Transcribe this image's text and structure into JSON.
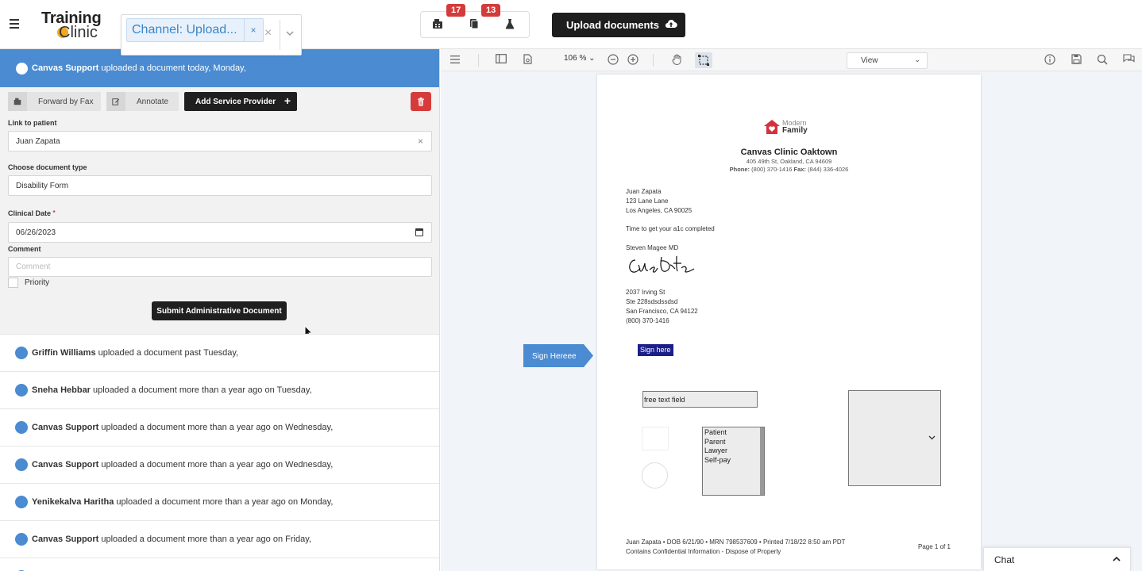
{
  "header": {
    "logo_line1": "Training",
    "logo_line2": "Clinic",
    "channel_chip": "Channel: Upload...",
    "chip_remove": "×",
    "clear": "×",
    "icons": [
      {
        "name": "fax-icon",
        "badge": "17"
      },
      {
        "name": "documents-icon",
        "badge": "13"
      },
      {
        "name": "lab-flask-icon",
        "badge": ""
      }
    ],
    "upload_label": "Upload documents"
  },
  "current_doc": {
    "user": "Canvas Support",
    "text": "uploaded a document today, Monday,"
  },
  "toolbar": {
    "forward_fax": "Forward by Fax",
    "annotate": "Annotate",
    "add_provider": "Add Service Provider"
  },
  "form": {
    "link_label": "Link to patient",
    "patient": "Juan Zapata",
    "doctype_label": "Choose document type",
    "doctype": "Disability Form",
    "clinical_date_label": "Clinical Date",
    "required_mark": "*",
    "clinical_date": "06/26/2023",
    "comment_label": "Comment",
    "comment_placeholder": "Comment",
    "priority_label": "Priority",
    "submit_label": "Submit Administrative Document"
  },
  "history": [
    {
      "user": "Griffin Williams",
      "text": "uploaded a document past Tuesday,"
    },
    {
      "user": "Sneha Hebbar",
      "text": "uploaded a document more than a year ago on Tuesday,"
    },
    {
      "user": "Canvas Support",
      "text": "uploaded a document more than a year ago on Wednesday,"
    },
    {
      "user": "Canvas Support",
      "text": "uploaded a document more than a year ago on Wednesday,"
    },
    {
      "user": "Yenikekalva Haritha",
      "text": "uploaded a document more than a year ago on Monday,"
    },
    {
      "user": "Canvas Support",
      "text": "uploaded a document more than a year ago on Friday,"
    }
  ],
  "viewer": {
    "zoom": "106 %",
    "view_mode": "View"
  },
  "document": {
    "logo_text_1": "Modern",
    "logo_text_2": "Family",
    "clinic_name": "Canvas Clinic Oaktown",
    "clinic_address": "405 49th St, Oakland, CA 94609",
    "phone_label": "Phone:",
    "phone": "(800) 370-1416",
    "fax_label": "Fax:",
    "fax": "(844) 336-4026",
    "recipient_lines": [
      "Juan Zapata",
      "123 Lane Lane",
      "Los Angeles, CA 90025"
    ],
    "message": "Time to get your a1c completed",
    "signer": "Steven Magee MD",
    "signature_text": "Carla Deta",
    "sender_lines": [
      "2037 Irving St",
      "Ste 228sdsdssdsd",
      "San Francisco, CA 94122",
      "(800) 370-1416"
    ],
    "sign_tag": "Sign Hereee",
    "sign_here": "Sign here",
    "free_text": "free text field",
    "list_options": [
      "Patient",
      "Parent",
      "Lawyer",
      "Self-pay"
    ],
    "footer_line1": "Juan Zapata • DOB 6/21/90 • MRN 798537609 • Printed 7/18/22 8:50 am PDT",
    "footer_line2": "Contains Confidential Information - Dispose of Properly",
    "page_label": "Page 1 of 1"
  },
  "chat": {
    "label": "Chat"
  },
  "colors": {
    "accent_blue": "#4a8bd1",
    "badge_red": "#d33b3b",
    "dark_button": "#1e1e1e"
  }
}
